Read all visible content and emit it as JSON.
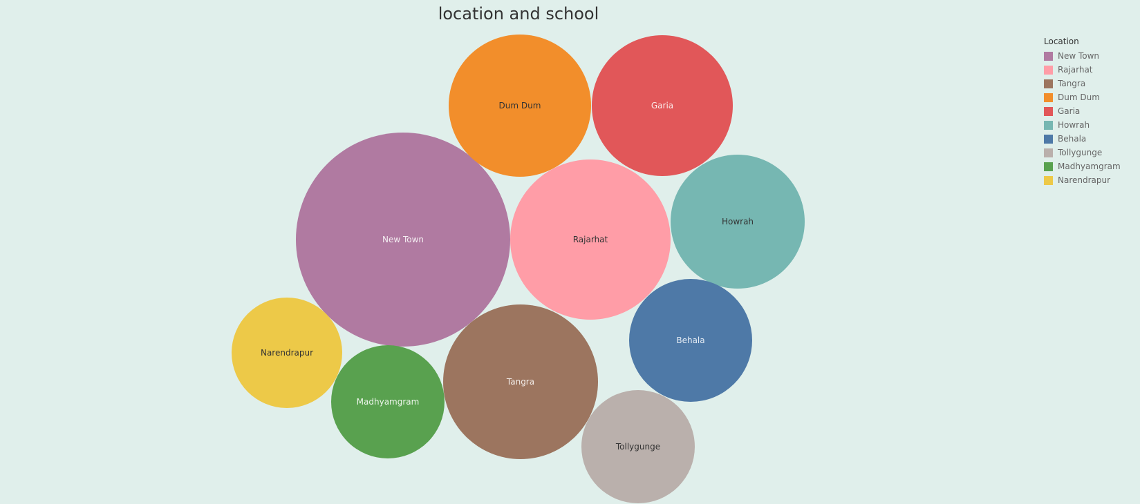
{
  "chart_data": {
    "type": "bubble",
    "title": "location and school",
    "legend": {
      "title": "Location",
      "placement": "top-right"
    },
    "series": [
      {
        "name": "New Town",
        "color": "#b07aa1",
        "label_color": "#f4eef2"
      },
      {
        "name": "Rajarhat",
        "color": "#ff9da7",
        "label_color": "#333333"
      },
      {
        "name": "Tangra",
        "color": "#9c755f",
        "label_color": "#f2ece8"
      },
      {
        "name": "Dum Dum",
        "color": "#f28e2b",
        "label_color": "#333333"
      },
      {
        "name": "Garia",
        "color": "#e15759",
        "label_color": "#fbeaea"
      },
      {
        "name": "Howrah",
        "color": "#76b7b2",
        "label_color": "#333333"
      },
      {
        "name": "Behala",
        "color": "#4e79a7",
        "label_color": "#e6edf5"
      },
      {
        "name": "Tollygunge",
        "color": "#bab0ac",
        "label_color": "#333333"
      },
      {
        "name": "Madhyamgram",
        "color": "#59a14f",
        "label_color": "#eef6ec"
      },
      {
        "name": "Narendrapur",
        "color": "#edc948",
        "label_color": "#333333"
      }
    ]
  }
}
